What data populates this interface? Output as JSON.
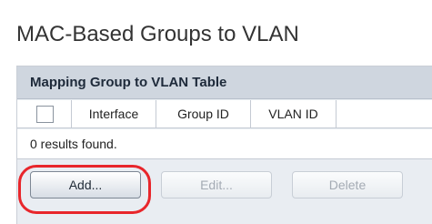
{
  "page": {
    "title": "MAC-Based Groups to VLAN"
  },
  "table": {
    "title": "Mapping Group to VLAN Table",
    "columns": [
      "Interface",
      "Group ID",
      "VLAN ID"
    ],
    "rows": [],
    "status": "0 results found."
  },
  "buttons": {
    "add": "Add...",
    "edit": "Edit...",
    "delete": "Delete"
  },
  "colors": {
    "highlight": "#e8262b",
    "panel_header": "#cfd6df"
  }
}
